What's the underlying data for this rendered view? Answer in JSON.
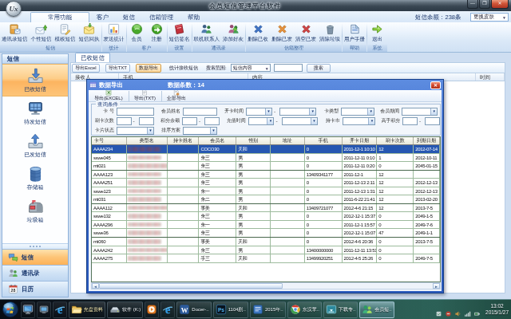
{
  "window": {
    "title": "会员短信管理平台软件",
    "logo_text": "Ux",
    "controls": {
      "minimize": "—",
      "maximize": "❐",
      "close": "✕"
    }
  },
  "ribbon": {
    "tabs": [
      {
        "label": "常用功能",
        "selected": true
      },
      {
        "label": "客户",
        "selected": false
      },
      {
        "label": "短信",
        "selected": false
      },
      {
        "label": "信箱管理",
        "selected": false
      },
      {
        "label": "帮助",
        "selected": false
      }
    ],
    "balance_label": "短信余额：238条",
    "skin_button": "更换皮肤",
    "groups": [
      {
        "caption": "短信",
        "items": [
          {
            "label": "通讯录短信",
            "icon": "addressbook-sms-icon"
          },
          {
            "label": "个性短信",
            "icon": "personal-sms-icon"
          },
          {
            "label": "模板短信",
            "icon": "template-sms-icon"
          },
          {
            "label": "短信回执",
            "icon": "receipt-sms-icon"
          }
        ]
      },
      {
        "caption": "统计",
        "items": [
          {
            "label": "发送统计",
            "icon": "chart-icon"
          }
        ]
      },
      {
        "caption": "客户",
        "items": [
          {
            "label": "会员",
            "icon": "member-orb-icon"
          },
          {
            "label": "注册",
            "icon": "register-orb-icon"
          }
        ]
      },
      {
        "caption": "设置",
        "items": [
          {
            "label": "短信签名",
            "icon": "signature-book-icon"
          }
        ]
      },
      {
        "caption": "通讯录",
        "items": [
          {
            "label": "联机联系人",
            "icon": "contacts-icon"
          },
          {
            "label": "添加好友",
            "icon": "add-friend-icon"
          }
        ]
      },
      {
        "caption": "信箱整理",
        "items": [
          {
            "label": "删除已收",
            "icon": "x-blue-icon"
          },
          {
            "label": "删除已发",
            "icon": "x-orange-icon"
          },
          {
            "label": "清空已发",
            "icon": "x-red-icon"
          },
          {
            "label": "清除垃圾",
            "icon": "trash-icon"
          }
        ]
      },
      {
        "caption": "帮助",
        "items": [
          {
            "label": "用户手册",
            "icon": "manual-book-icon"
          }
        ]
      },
      {
        "caption": "系统",
        "items": [
          {
            "label": "退出",
            "icon": "exit-arrow-icon"
          }
        ]
      }
    ]
  },
  "sidebar": {
    "header": "短信",
    "folders": [
      {
        "label": "已收短信",
        "icon": "inbox-tray-icon",
        "selected": true
      },
      {
        "label": "待发短信",
        "icon": "outbox-queue-icon",
        "selected": false
      },
      {
        "label": "已发短信",
        "icon": "sent-tray-icon",
        "selected": false
      },
      {
        "label": "存储箱",
        "icon": "storage-box-icon",
        "selected": false
      },
      {
        "label": "垃圾箱",
        "icon": "junk-mailbox-icon",
        "selected": false
      }
    ],
    "sections": [
      {
        "label": "短信",
        "icon": "sms-bubbles-icon",
        "selected": true
      },
      {
        "label": "通讯录",
        "icon": "contacts-people-icon",
        "selected": false
      },
      {
        "label": "日历",
        "icon": "calendar-icon",
        "selected": false
      }
    ],
    "calendar_day": "28"
  },
  "main": {
    "tab": "已收短信",
    "toolbar": {
      "buttons": [
        {
          "label": "导出Excel",
          "highlighted": false
        },
        {
          "label": "导出TXT",
          "highlighted": false
        },
        {
          "label": "数据导出",
          "highlighted": true
        }
      ],
      "stat_label": "统计接收短信",
      "search_label": "搜索范围:",
      "search_scope": "短信内容",
      "search_value": "",
      "search_button": "搜索"
    },
    "table_headers": [
      "接收人",
      "手机",
      "内容",
      "时间"
    ]
  },
  "dialog": {
    "title": "数据导出",
    "count_label": "数据条数：14",
    "close_glyph": "✕",
    "toolbar": [
      {
        "label": "导出(EXCEL)",
        "icon": "excel-icon"
      },
      {
        "label": "导出(TXT)",
        "icon": "txt-icon"
      },
      {
        "label": "全部导出",
        "icon": "export-all-icon"
      }
    ],
    "query": {
      "caption": "查询条件",
      "rows": [
        [
          {
            "label": "卡  号",
            "type": "input"
          },
          {
            "label": "会员姓名",
            "type": "input"
          },
          {
            "label": "开卡时间",
            "type": "ddpair"
          },
          {
            "label": "卡类型",
            "type": "dd"
          },
          {
            "label": "会员期间",
            "type": "dd"
          }
        ],
        [
          {
            "label": "刷卡次数",
            "type": "range"
          },
          {
            "label": "积分余额",
            "type": "range"
          },
          {
            "label": "充值时间",
            "type": "ddpair"
          },
          {
            "label": "持卡市",
            "type": "dd"
          },
          {
            "label": "高于积分",
            "type": "range"
          }
        ],
        [
          {
            "label": "卡片状态",
            "type": "dd"
          },
          {
            "label": "排序方案",
            "type": "dd"
          }
        ]
      ]
    },
    "grid": {
      "headers": [
        "卡号",
        "类型名",
        "持卡姓名",
        "会员名",
        "性别",
        "地址",
        "手机",
        "开卡日期",
        "刷卡次数",
        "到期日期"
      ],
      "rows": [
        {
          "sel": true,
          "mosaic": 1,
          "c": [
            "AAAA234",
            "",
            "",
            "COCO30",
            "天和",
            "",
            "0",
            "2011-12-1 10:10",
            "12",
            "2012-07-14"
          ]
        },
        {
          "sel": false,
          "mosaic": 1,
          "c": [
            "sswe045",
            "",
            "",
            "朱三",
            "男",
            "",
            "0",
            "2011-12-11 0:10",
            "1",
            "2012-10-11"
          ]
        },
        {
          "sel": false,
          "mosaic": 2,
          "c": [
            "rrtt021",
            "",
            "",
            "朱三",
            "男",
            "",
            "0",
            "2011-12-11 0:20",
            "0",
            "2045-01-15"
          ]
        },
        {
          "sel": false,
          "mosaic": 1,
          "c": [
            "AAAA123",
            "",
            "",
            "朱三",
            "男",
            "",
            "13409341177",
            "2011-12-1",
            "12",
            ""
          ]
        },
        {
          "sel": false,
          "mosaic": 1,
          "c": [
            "AAAA251",
            "",
            "",
            "朱三",
            "男",
            "",
            "0",
            "2011-12-13 2:11",
            "12",
            "2012-12-13"
          ]
        },
        {
          "sel": false,
          "mosaic": 1,
          "c": [
            "sswe123",
            "",
            "",
            "朱一",
            "男",
            "",
            "0",
            "2011-12-13 1:31",
            "12",
            "2012-12-13"
          ]
        },
        {
          "sel": false,
          "mosaic": 1,
          "c": [
            "rrtt031",
            "",
            "",
            "朱二",
            "男",
            "",
            "0",
            "2011-6-22 21:41",
            "12",
            "2013-02-20"
          ]
        },
        {
          "sel": false,
          "mosaic": 2,
          "c": [
            "AAAA112",
            "",
            "",
            "事美",
            "天和",
            "",
            "13409721077",
            "2012-4-6 21:15",
            "12",
            "2013-7-5"
          ]
        },
        {
          "sel": false,
          "mosaic": 1,
          "c": [
            "sswe132",
            "",
            "",
            "朱三",
            "男",
            "",
            "0",
            "2012-12-1 15:37",
            "0",
            "2049-1-5"
          ]
        },
        {
          "sel": false,
          "mosaic": 1,
          "c": [
            "AAAA296",
            "",
            "",
            "朱一",
            "男",
            "",
            "0",
            "2011-12-1 15:57",
            "0",
            "2049-7-6"
          ]
        },
        {
          "sel": false,
          "mosaic": 1,
          "c": [
            "sswe36",
            "",
            "",
            "朱三",
            "男",
            "",
            "0",
            "2012-12-1 15:07",
            "47",
            "2049-1-1"
          ]
        },
        {
          "sel": false,
          "mosaic": 1,
          "c": [
            "rrtt060",
            "",
            "",
            "事美",
            "天和",
            "",
            "0",
            "2012-4-6 20:36",
            "0",
            "2013-7-5"
          ]
        },
        {
          "sel": false,
          "mosaic": 2,
          "c": [
            "AAAA242",
            "",
            "",
            "朱三",
            "男",
            "",
            "13400000000",
            "2011-12-11 13:51",
            "0",
            ""
          ]
        },
        {
          "sel": false,
          "mosaic": 1,
          "c": [
            "AAAA275",
            "",
            "",
            "手三",
            "天和",
            "",
            "13499920251",
            "2012-4-5 25:26",
            "0",
            "2049-7-5"
          ]
        }
      ]
    }
  },
  "taskbar": {
    "buttons": [
      {
        "icon": "monitor-icon",
        "label": ""
      },
      {
        "icon": "display-small-icon",
        "label": ""
      },
      {
        "icon": "ie-icon",
        "label": ""
      },
      {
        "icon": "folder-icon",
        "label": "光盘资料"
      },
      {
        "icon": "drive-icon",
        "label": "软件 (K:)"
      },
      {
        "icon": "media-icon",
        "label": ""
      },
      {
        "icon": "ie-icon",
        "label": ""
      },
      {
        "icon": "word-icon",
        "label": "Docer-.."
      },
      {
        "icon": "photoshop-icon",
        "label": "1104剧.."
      },
      {
        "icon": "notes-icon",
        "label": "2015年.."
      },
      {
        "icon": "chrome-icon",
        "label": "东汉苹.."
      },
      {
        "icon": "download-icon",
        "label": "下载专.."
      },
      {
        "icon": "sms-app-icon",
        "label": "会员短..",
        "active": true
      }
    ],
    "tray_icons": [
      "tray-white-icon",
      "tray-red-icon",
      "tray-volume-icon",
      "tray-network-icon",
      "tray-power-icon"
    ],
    "clock": {
      "time": "13:02",
      "date": "2015/1/27"
    }
  }
}
